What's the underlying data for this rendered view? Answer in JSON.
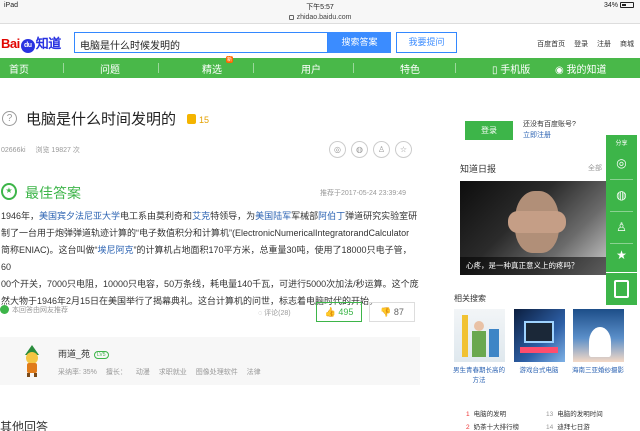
{
  "status_bar": {
    "device": "iPad",
    "time": "下午5:57",
    "battery": "34%"
  },
  "url_bar": {
    "url": "zhidao.baidu.com"
  },
  "header": {
    "logo": {
      "bai": "Bai",
      "paw": "du",
      "zhidao": "知道"
    },
    "search_value": "电脑是什么时候发明的",
    "search_button": "搜索答案",
    "ask_button": "我要提问",
    "links": [
      "百度首页",
      "登录",
      "注册",
      "商城"
    ]
  },
  "nav": {
    "items": [
      "首页",
      "问题",
      "精选",
      "用户",
      "特色",
      "手机版",
      "我的知道"
    ],
    "tag": "新"
  },
  "question": {
    "title": "电脑是什么时间发明的",
    "reward": "15",
    "asker": "02666ki",
    "views": "浏览 19827 次"
  },
  "best_answer": {
    "title": "最佳答案",
    "date": "推荐于2017-05-24 23:39:49",
    "lines": [
      [
        {
          "t": "1946年，"
        },
        {
          "t": "美国宾夕法尼亚大学",
          "link": true
        },
        {
          "t": "电工系由莫利奇和"
        },
        {
          "t": "艾克",
          "link": true
        },
        {
          "t": "特领导，为"
        },
        {
          "t": "美国陆军",
          "link": true
        },
        {
          "t": "军械部"
        },
        {
          "t": "阿伯丁",
          "link": true
        },
        {
          "t": "弹道研究实验室研"
        }
      ],
      [
        {
          "t": "制了一台用于炮弹弹道轨迹计算的“电子数值积分和计算机”(ElectronicNumericalIntegratorandCalculator"
        }
      ],
      [
        {
          "t": "简称ENIAC)。这台叫做“"
        },
        {
          "t": "埃尼阿克",
          "link": true
        },
        {
          "t": "”的计算机占地面积170平方米，总重量30吨，使用了18000只电子管，60"
        }
      ],
      [
        {
          "t": "00个开关，7000只电阻，10000只电容，50万条线，耗电量140千瓦，可进行5000次加法/秒运算。这个庞"
        }
      ],
      [
        {
          "t": "然大物于1946年2月15日在美国举行了揭幕典礼。这台计算机的问世，标志着电脑时代的开始。"
        }
      ]
    ],
    "recommended": "本回答由网友推荐",
    "comment": "评论(28)",
    "likes": "495",
    "dislikes": "87"
  },
  "answerer": {
    "name": "雨道_苑",
    "level": "LV5",
    "stats": [
      "采纳率: 35%",
      "擅长：",
      "动漫",
      "求职就业",
      "图像处理软件",
      "法律"
    ]
  },
  "other_answers_title": "其他回答",
  "sidebar": {
    "login_button": "登录",
    "no_account": "还没有百度账号?",
    "register_now": "立即注册",
    "daily_title": "知道日报",
    "daily_more": "全部",
    "daily_caption": "心疼，是一种真正意义上的疼吗？",
    "related_title": "相关搜索",
    "thumbs": [
      {
        "caption": "男生青春期长高的方法"
      },
      {
        "caption": "游戏台式电脑"
      },
      {
        "caption": "海南三亚婚纱摄影"
      }
    ],
    "rank": [
      {
        "num": "1",
        "text": "电脑的发明"
      },
      {
        "num": "2",
        "text": "奶茶十大排行榜"
      },
      {
        "num": "13",
        "text": "电脑的发明时间"
      },
      {
        "num": "14",
        "text": "迪拜七日游"
      }
    ]
  },
  "float_bar": {
    "share_label": "分享"
  },
  "colors": {
    "green": "#3db549",
    "nav_green": "#49b849",
    "link_blue": "#2d64b3",
    "search_blue": "#3b8cff"
  }
}
